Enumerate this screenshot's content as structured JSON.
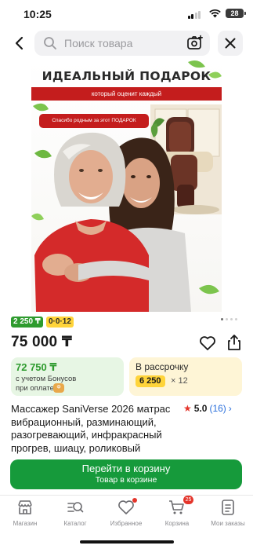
{
  "status_bar": {
    "time": "10:25",
    "battery": "28"
  },
  "search": {
    "placeholder": "Поиск товара"
  },
  "product_image": {
    "headline": "ИДЕАЛЬНЫЙ ПОДАРОК",
    "strip_text": "который оценит каждый",
    "bubble_text": "Спасибо родным за этот ПОДАРОК"
  },
  "badges": {
    "green": "2 250 ₸",
    "yellow": "0·0·12"
  },
  "price": "75 000 ₸",
  "bonus_card": {
    "amount": "72 750 ₸",
    "line1": "с учетом Бонусов",
    "line2": "при оплате",
    "coin": "Ф"
  },
  "installment_card": {
    "title": "В рассрочку",
    "monthly": "6 250",
    "multiplier": "× 12"
  },
  "product": {
    "title": "Массажер SaniVerse 2026 матрас вибрационный, разминающий, разогревающий, инфракрасный прогрев, шиацу, роликовый",
    "rating": "5.0",
    "reviews": "(16)"
  },
  "cart_button": {
    "label": "Перейти в корзину",
    "sub": "Товар в корзине"
  },
  "tabbar": [
    {
      "label": "Магазин",
      "icon": "shop-icon"
    },
    {
      "label": "Каталог",
      "icon": "catalog-icon"
    },
    {
      "label": "Избранное",
      "icon": "heart-icon"
    },
    {
      "label": "Корзина",
      "icon": "cart-icon",
      "badge": "25"
    },
    {
      "label": "Мои заказы",
      "icon": "orders-icon"
    }
  ],
  "colors": {
    "brand_green": "#169a3b",
    "bonus_green": "#2e9b2e",
    "accent_red": "#c41d1d",
    "installment_yellow": "#ffd43a",
    "link_blue": "#2a6fdb"
  }
}
